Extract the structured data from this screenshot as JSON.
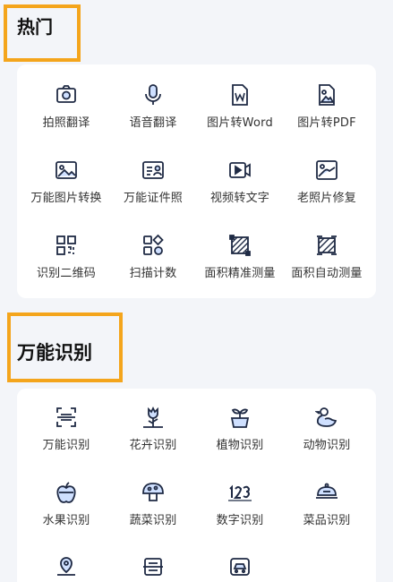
{
  "hot": {
    "title": "热门",
    "items": [
      {
        "label": "拍照翻译",
        "icon": "camera-translate-icon"
      },
      {
        "label": "语音翻译",
        "icon": "microphone-icon"
      },
      {
        "label": "图片转Word",
        "icon": "word-doc-icon"
      },
      {
        "label": "图片转PDF",
        "icon": "image-doc-icon"
      },
      {
        "label": "万能图片转换",
        "icon": "image-convert-icon"
      },
      {
        "label": "万能证件照",
        "icon": "id-card-icon"
      },
      {
        "label": "视频转文字",
        "icon": "video-icon"
      },
      {
        "label": "老照片修复",
        "icon": "photo-restore-icon"
      },
      {
        "label": "识别二维码",
        "icon": "qr-code-icon"
      },
      {
        "label": "扫描计数",
        "icon": "scan-count-icon"
      },
      {
        "label": "面积精准测量",
        "icon": "area-measure-icon"
      },
      {
        "label": "面积自动测量",
        "icon": "area-auto-measure-icon"
      }
    ]
  },
  "recognize": {
    "title": "万能识别",
    "items": [
      {
        "label": "万能识别",
        "icon": "scan-frame-icon"
      },
      {
        "label": "花卉识别",
        "icon": "flower-icon"
      },
      {
        "label": "植物识别",
        "icon": "plant-icon"
      },
      {
        "label": "动物识别",
        "icon": "duck-icon"
      },
      {
        "label": "水果识别",
        "icon": "apple-icon"
      },
      {
        "label": "蔬菜识别",
        "icon": "mushroom-icon"
      },
      {
        "label": "数字识别",
        "icon": "numbers-icon"
      },
      {
        "label": "菜品识别",
        "icon": "dish-icon"
      },
      {
        "label": "",
        "icon": "landmark-icon"
      },
      {
        "label": "",
        "icon": "document-scan-icon"
      },
      {
        "label": "",
        "icon": "car-icon"
      }
    ]
  },
  "colors": {
    "highlight": "#f4a51c",
    "icon_stroke": "#1f2a44",
    "icon_accent": "#cfe0ff"
  }
}
